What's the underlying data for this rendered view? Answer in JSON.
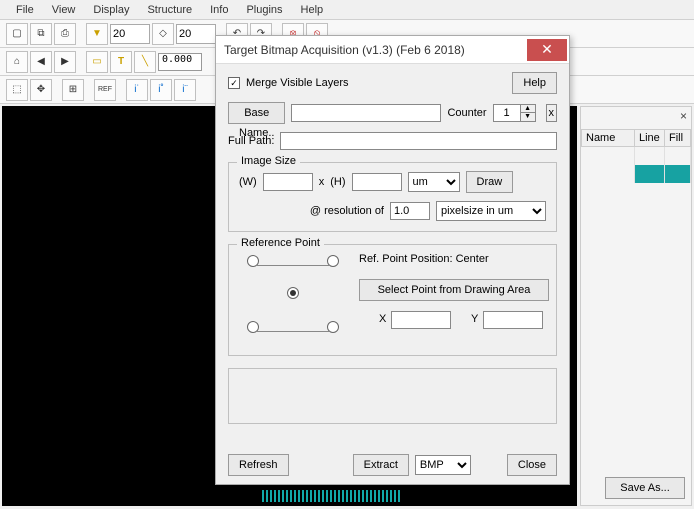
{
  "menu": [
    "File",
    "View",
    "Display",
    "Structure",
    "Info",
    "Plugins",
    "Help"
  ],
  "toolbar1_combo1": "20",
  "toolbar1_combo2": "20",
  "toolbar2_value": "0.000",
  "dialog": {
    "title": "Target Bitmap Acquisition (v1.3) (Feb  6 2018)",
    "merge_label": "Merge Visible Layers",
    "merge_checked": "✓",
    "help": "Help",
    "base_name_btn": "Base Name..",
    "counter_label": "Counter",
    "counter_value": "1",
    "x_btn": "x",
    "full_path_label": "Full Path:",
    "imgsz": {
      "legend": "Image Size",
      "w": "(W)",
      "x": "x",
      "h": "(H)",
      "unit": "um",
      "draw": "Draw",
      "at_res": "@ resolution of",
      "res_value": "1.0",
      "pixelsize": "pixelsize in um"
    },
    "refpt": {
      "legend": "Reference Point",
      "pos_label": "Ref. Point Position: Center",
      "select_btn": "Select Point from Drawing Area",
      "X": "X",
      "Y": "Y"
    },
    "refresh": "Refresh",
    "extract": "Extract",
    "format": "BMP",
    "close": "Close"
  },
  "side": {
    "cols": [
      "Name",
      "Line",
      "Fill"
    ],
    "saveas": "Save As..."
  }
}
